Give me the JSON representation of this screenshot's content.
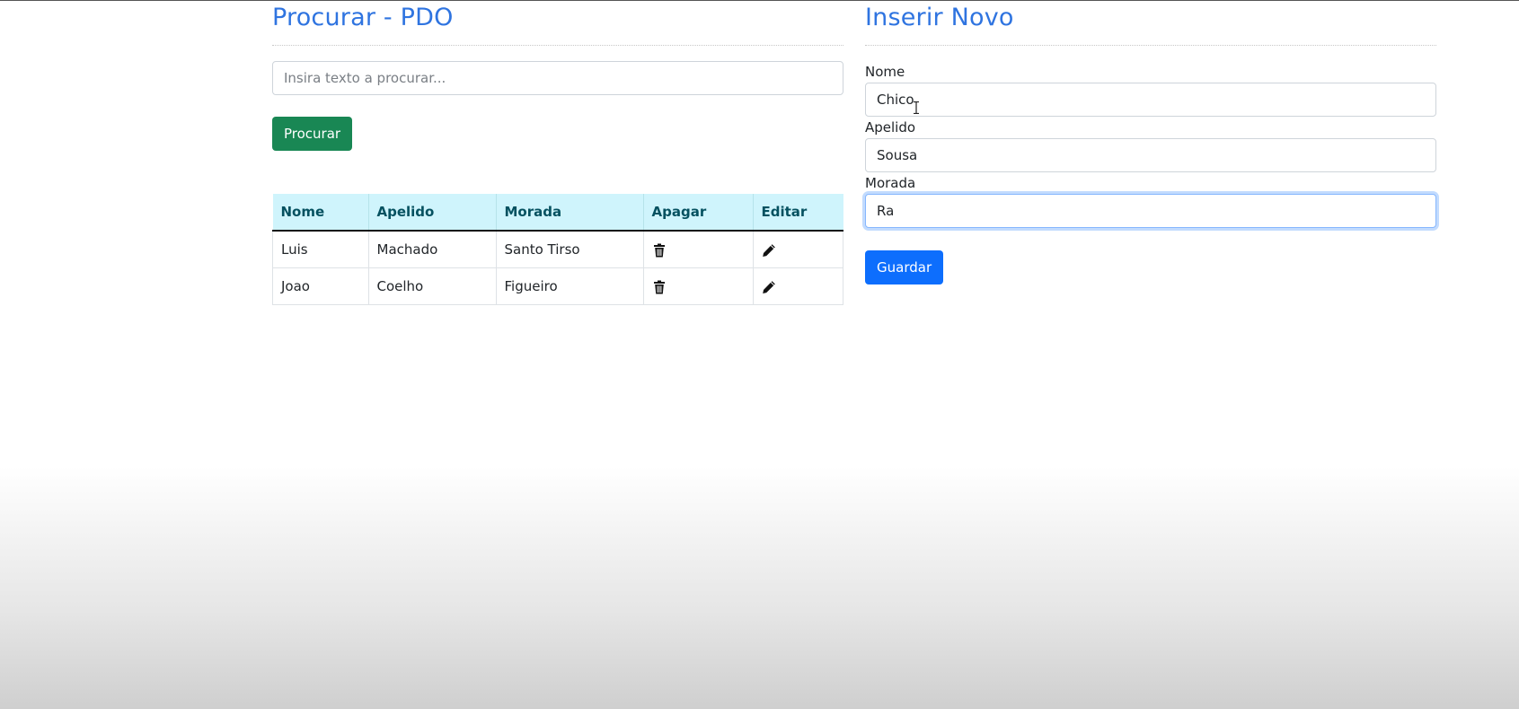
{
  "search_section": {
    "title": "Procurar - PDO",
    "search_placeholder": "Insira texto a procurar...",
    "search_value": "",
    "search_button": "Procurar",
    "table": {
      "headers": [
        "Nome",
        "Apelido",
        "Morada",
        "Apagar",
        "Editar"
      ],
      "rows": [
        {
          "nome": "Luis",
          "apelido": "Machado",
          "morada": "Santo Tirso",
          "delete_icon": "trash-icon",
          "edit_icon": "pencil-icon"
        },
        {
          "nome": "Joao",
          "apelido": "Coelho",
          "morada": "Figueiro",
          "delete_icon": "trash-icon",
          "edit_icon": "pencil-icon"
        }
      ]
    }
  },
  "insert_section": {
    "title": "Inserir Novo",
    "fields": {
      "nome": {
        "label": "Nome",
        "value": "Chico"
      },
      "apelido": {
        "label": "Apelido",
        "value": "Sousa"
      },
      "morada": {
        "label": "Morada",
        "value": "Ra"
      }
    },
    "save_button": "Guardar"
  },
  "colors": {
    "title": "#2f74e0",
    "search_button": "#198754",
    "save_button": "#0d6efd",
    "table_header_bg": "#cff4fc",
    "table_header_text": "#055160"
  }
}
